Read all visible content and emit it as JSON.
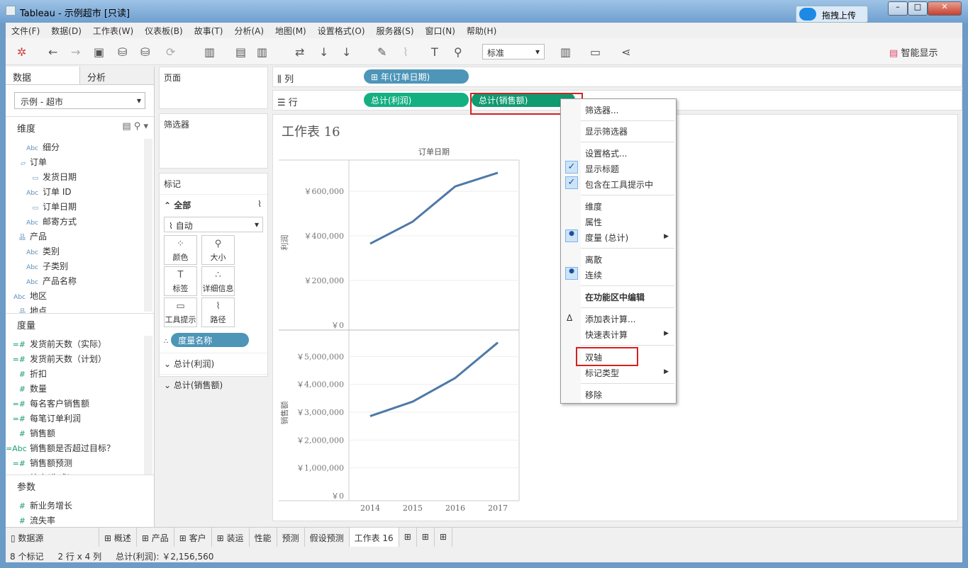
{
  "window": {
    "title": "Tableau - 示例超市 [只读]",
    "upload": "拖拽上传"
  },
  "menu": [
    "文件(F)",
    "数据(D)",
    "工作表(W)",
    "仪表板(B)",
    "故事(T)",
    "分析(A)",
    "地图(M)",
    "设置格式(O)",
    "服务器(S)",
    "窗口(N)",
    "帮助(H)"
  ],
  "toolbar": {
    "fit": "标准",
    "show_me": "智能显示"
  },
  "left": {
    "tabs": [
      "数据",
      "分析"
    ],
    "datasource": "示例 - 超市",
    "dim_title": "维度",
    "measure_title": "度量",
    "param_title": "参数",
    "dimensions": [
      {
        "icon": "Abc",
        "label": "细分",
        "f": 1
      },
      {
        "icon": "folder",
        "label": "订单",
        "f": 0
      },
      {
        "icon": "date",
        "label": "发货日期",
        "f": 1
      },
      {
        "icon": "Abc",
        "label": "订单 ID",
        "f": 1
      },
      {
        "icon": "date",
        "label": "订单日期",
        "f": 1
      },
      {
        "icon": "Abc",
        "label": "邮寄方式",
        "f": 1
      },
      {
        "icon": "hier",
        "label": "产品",
        "f": 0
      },
      {
        "icon": "Abc",
        "label": "类别",
        "f": 1
      },
      {
        "icon": "Abc",
        "label": "子类别",
        "f": 1
      },
      {
        "icon": "Abc",
        "label": "产品名称",
        "f": 1
      },
      {
        "icon": "Abc",
        "label": "地区",
        "f": 0
      },
      {
        "icon": "hier",
        "label": "地点",
        "f": 0
      }
    ],
    "measures": [
      {
        "icon": "=#",
        "label": "发货前天数（实际）"
      },
      {
        "icon": "=#",
        "label": "发货前天数（计划）"
      },
      {
        "icon": "#",
        "label": "折扣"
      },
      {
        "icon": "#",
        "label": "数量"
      },
      {
        "icon": "=#",
        "label": "每名客户销售额"
      },
      {
        "icon": "=#",
        "label": "每笔订单利润"
      },
      {
        "icon": "#",
        "label": "销售额"
      },
      {
        "icon": "=Abc",
        "label": "销售额是否超过目标？"
      },
      {
        "icon": "=#",
        "label": "销售额预测"
      },
      {
        "icon": "⊕",
        "label": "纬度(生成)"
      }
    ],
    "params": [
      {
        "icon": "#",
        "label": "新业务增长"
      },
      {
        "icon": "#",
        "label": "流失率"
      }
    ]
  },
  "cards": {
    "pages": "页面",
    "filters": "筛选器",
    "marks": "标记",
    "all": "全部",
    "mark_type": "自动",
    "buttons": [
      "颜色",
      "大小",
      "标签",
      "详细信息",
      "工具提示",
      "路径"
    ],
    "measure_names": "度量名称",
    "sum_profit": "总计(利润)",
    "sum_sales": "总计(销售额)"
  },
  "shelves": {
    "columns_label": "列",
    "rows_label": "行",
    "columns_pill": "年(订单日期)",
    "rows_pills": [
      "总计(利润)",
      "总计(销售额)"
    ]
  },
  "sheet": {
    "title": "工作表  16"
  },
  "chart_data": {
    "type": "line",
    "title": "",
    "column_header": "订单日期",
    "x": [
      "2014",
      "2015",
      "2016",
      "2017"
    ],
    "panes": [
      {
        "ylabel": "利润",
        "ylim": [
          0,
          740000
        ],
        "ticks": [
          "￥0",
          "￥200,000",
          "￥400,000",
          "￥600,000"
        ],
        "tick_values": [
          0,
          200000,
          400000,
          600000
        ],
        "values": [
          365000,
          464000,
          622000,
          683000
        ]
      },
      {
        "ylabel": "销售额",
        "ylim": [
          0,
          5950000
        ],
        "ticks": [
          "￥0",
          "￥1,000,000",
          "￥2,000,000",
          "￥3,000,000",
          "￥4,000,000",
          "￥5,000,000"
        ],
        "tick_values": [
          0,
          1000000,
          2000000,
          3000000,
          4000000,
          5000000
        ],
        "values": [
          2860000,
          3380000,
          4230000,
          5500000
        ]
      }
    ],
    "line_color": "#4e79a7"
  },
  "context_menu": [
    {
      "label": "筛选器...",
      "top": 7
    },
    {
      "sep": 30
    },
    {
      "label": "显示筛选器",
      "top": 37
    },
    {
      "sep": 60
    },
    {
      "label": "设置格式...",
      "top": 68
    },
    {
      "label": "显示标题",
      "top": 90,
      "check": "✓"
    },
    {
      "label": "包含在工具提示中",
      "top": 112,
      "check": "✓"
    },
    {
      "sep": 135
    },
    {
      "label": "维度",
      "top": 143
    },
    {
      "label": "属性",
      "top": 165
    },
    {
      "label": "度量 (总计)",
      "top": 187,
      "check": "●",
      "sub": true
    },
    {
      "sep": 210
    },
    {
      "label": "离散",
      "top": 218
    },
    {
      "label": "连续",
      "top": 240,
      "check": "●"
    },
    {
      "sep": 263
    },
    {
      "label": "在功能区中编辑",
      "top": 271,
      "bold": true
    },
    {
      "sep": 294
    },
    {
      "label": "添加表计算...",
      "top": 302,
      "mark": "Δ"
    },
    {
      "label": "快速表计算",
      "top": 324,
      "sub": true
    },
    {
      "sep": 347
    },
    {
      "label": "双轴",
      "top": 356
    },
    {
      "label": "标记类型",
      "top": 378,
      "sub": true
    },
    {
      "sep": 401
    },
    {
      "label": "移除",
      "top": 409
    }
  ],
  "bottom_tabs": [
    "数据源",
    "概述",
    "产品",
    "客户",
    "装运",
    "性能",
    "预测",
    "假设预测",
    "工作表 16"
  ],
  "status": {
    "marks": "8 个标记",
    "dims": "2 行 x 4 列",
    "sum": "总计(利润): ￥2,156,560"
  }
}
